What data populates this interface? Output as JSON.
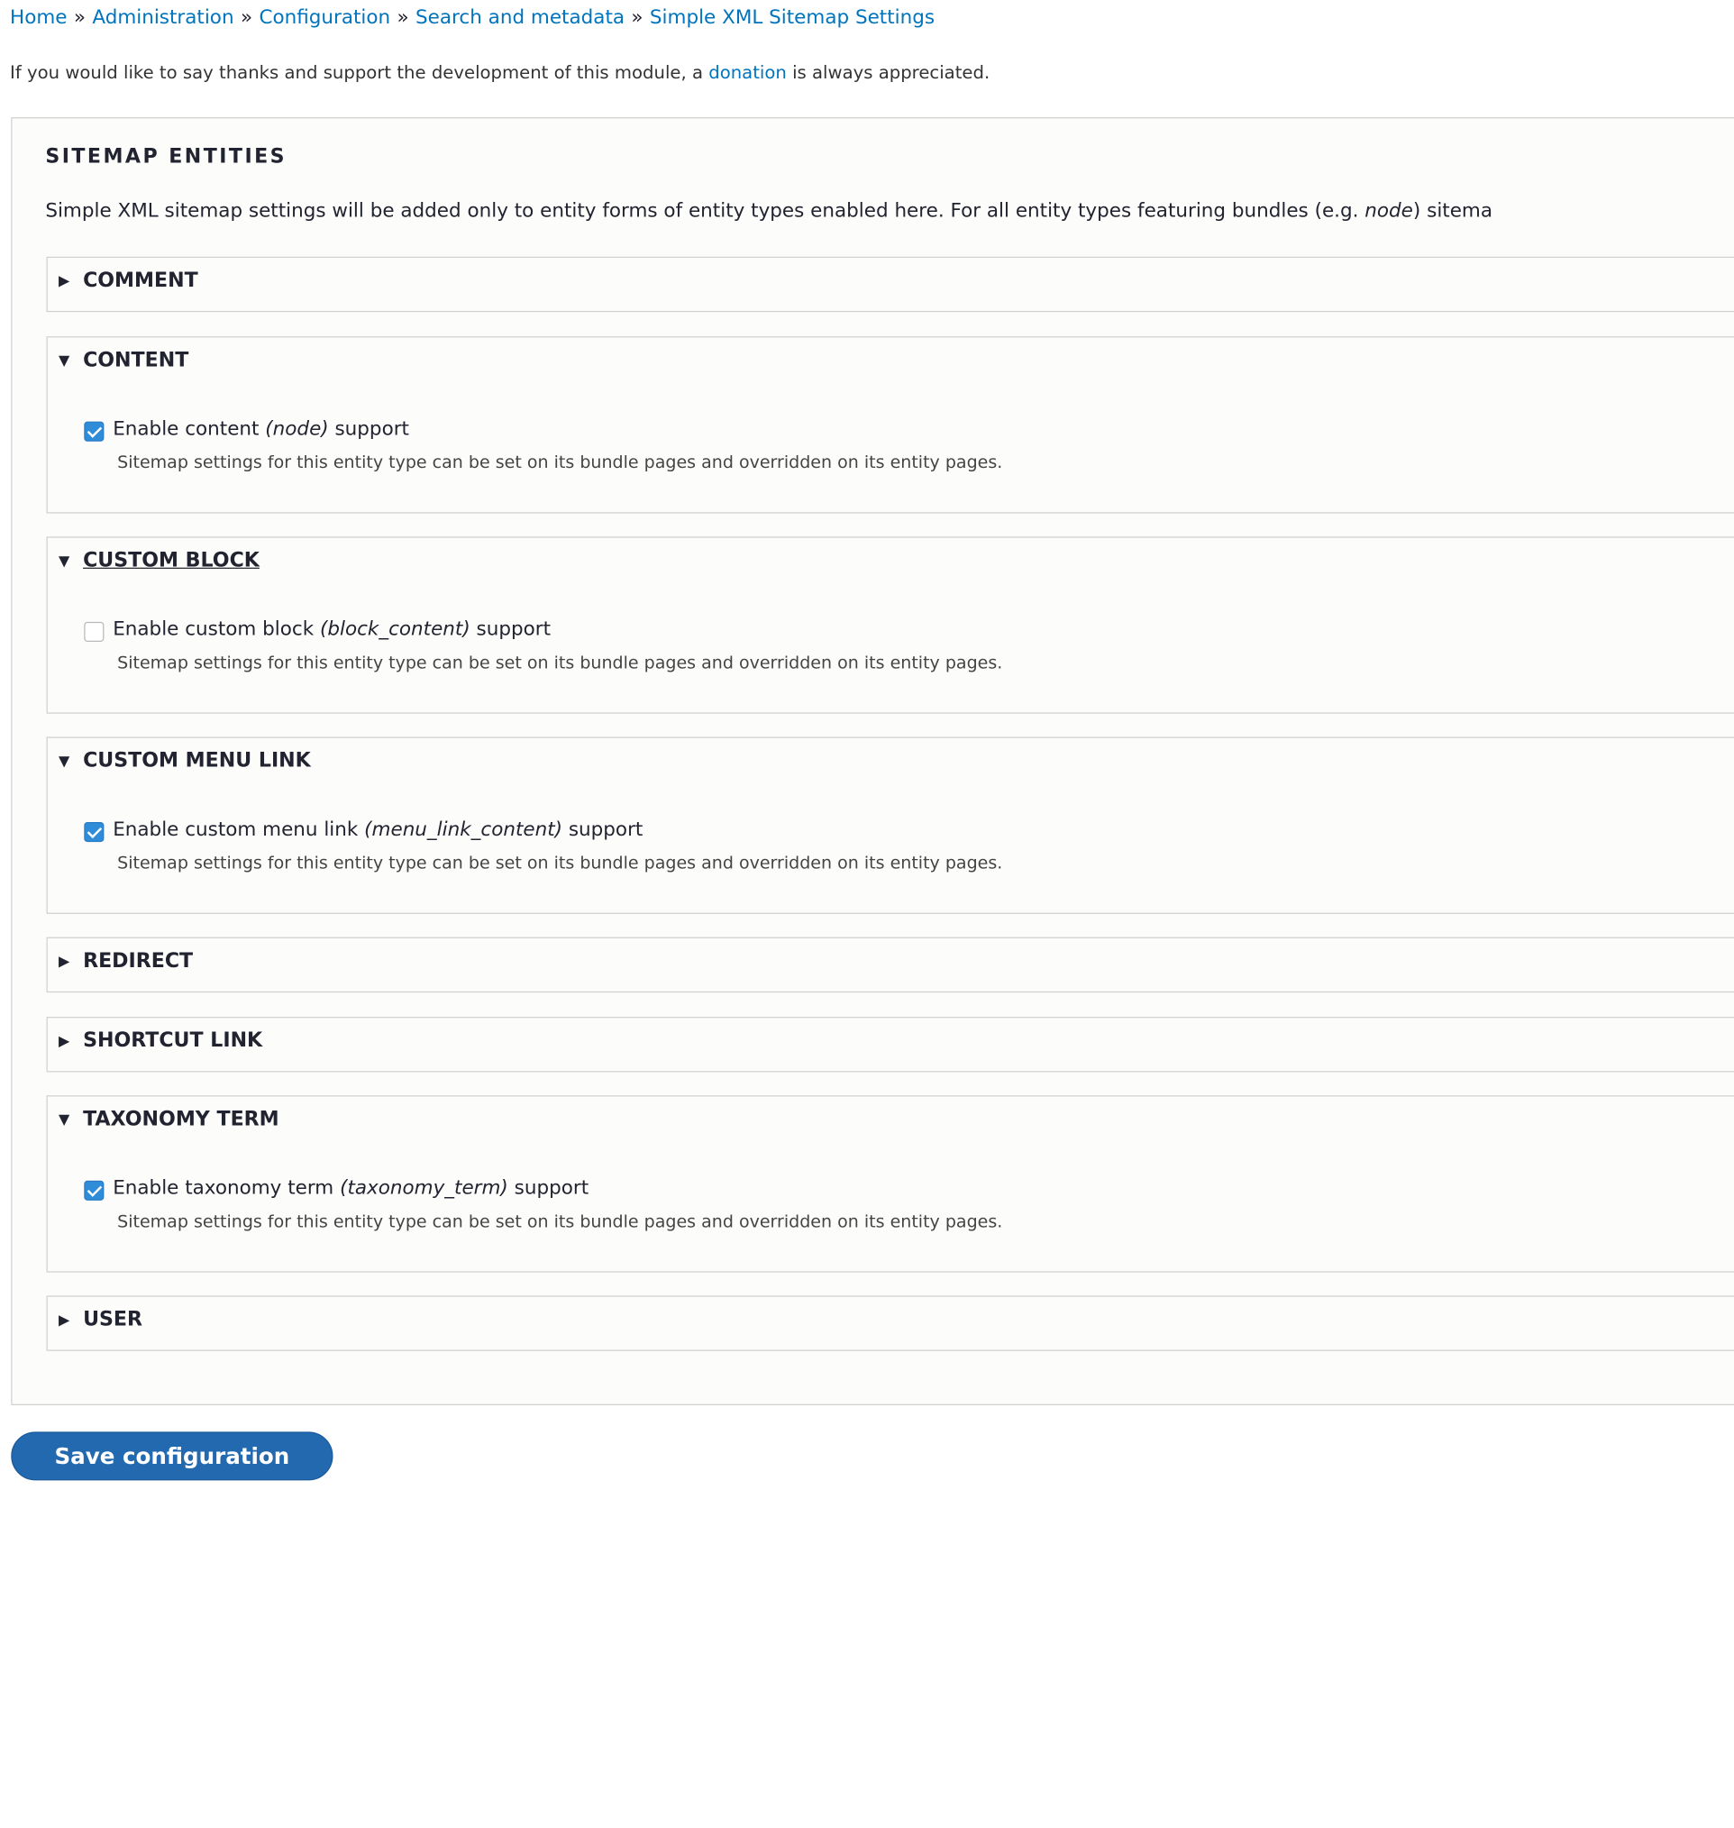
{
  "breadcrumb": {
    "items": [
      "Home",
      "Administration",
      "Configuration",
      "Search and metadata",
      "Simple XML Sitemap Settings"
    ],
    "separator": "»"
  },
  "intro": {
    "before": "If you would like to say thanks and support the development of this module, a ",
    "link": "donation",
    "after": " is always appreciated."
  },
  "fieldset": {
    "legend": "SITEMAP ENTITIES",
    "description_before": "Simple XML sitemap settings will be added only to entity forms of entity types enabled here. For all entity types featuring bundles (e.g. ",
    "description_em": "node",
    "description_after": ") sitema"
  },
  "sections": {
    "comment": {
      "title": "COMMENT",
      "open": false
    },
    "content": {
      "title": "CONTENT",
      "open": true,
      "option": {
        "prefix": "Enable content ",
        "machine": "(node)",
        "suffix": " support",
        "checked": true
      },
      "description": "Sitemap settings for this entity type can be set on its bundle pages and overridden on its entity pages."
    },
    "custom_block": {
      "title": "CUSTOM BLOCK",
      "open": true,
      "option": {
        "prefix": "Enable custom block ",
        "machine": "(block_content)",
        "suffix": " support",
        "checked": false
      },
      "description": "Sitemap settings for this entity type can be set on its bundle pages and overridden on its entity pages."
    },
    "custom_menu_link": {
      "title": "CUSTOM MENU LINK",
      "open": true,
      "option": {
        "prefix": "Enable custom menu link ",
        "machine": "(menu_link_content)",
        "suffix": " support",
        "checked": true
      },
      "description": "Sitemap settings for this entity type can be set on its bundle pages and overridden on its entity pages."
    },
    "redirect": {
      "title": "REDIRECT",
      "open": false
    },
    "shortcut_link": {
      "title": "SHORTCUT LINK",
      "open": false
    },
    "taxonomy_term": {
      "title": "TAXONOMY TERM",
      "open": true,
      "option": {
        "prefix": "Enable taxonomy term ",
        "machine": "(taxonomy_term)",
        "suffix": " support",
        "checked": true
      },
      "description": "Sitemap settings for this entity type can be set on its bundle pages and overridden on its entity pages."
    },
    "user": {
      "title": "USER",
      "open": false
    }
  },
  "icons": {
    "collapsed": "triangle-right-icon",
    "expanded": "triangle-down-icon"
  },
  "colors": {
    "link": "#0074bd",
    "primary_button": "#2369b0",
    "checkbox_checked": "#2f8cd8"
  },
  "actions": {
    "save_label": "Save configuration"
  }
}
